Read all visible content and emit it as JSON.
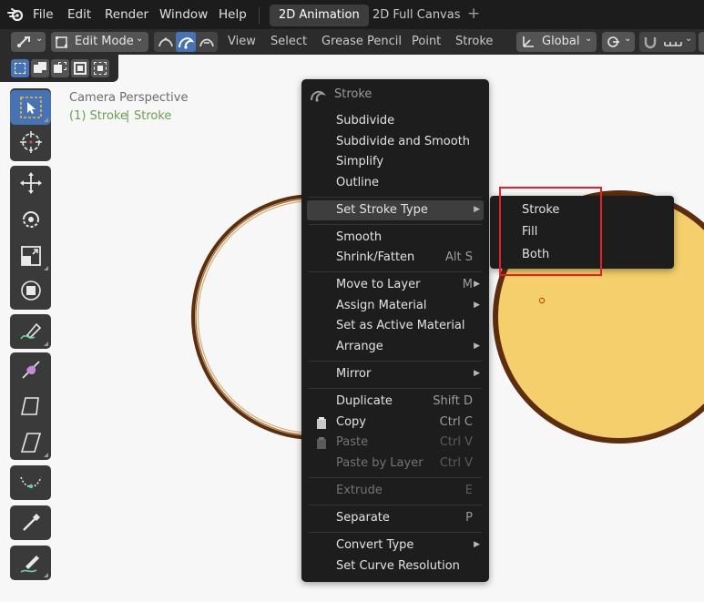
{
  "topbar": {
    "menus": [
      "File",
      "Edit",
      "Render",
      "Window",
      "Help"
    ],
    "tabs": [
      "2D Animation",
      "2D Full Canvas"
    ],
    "add_tab": "+"
  },
  "header": {
    "mode": "Edit Mode",
    "menus": [
      "View",
      "Select",
      "Grease Pencil",
      "Point",
      "Stroke"
    ],
    "orientation": "Global"
  },
  "viewport": {
    "camera": "Camera Perspective",
    "object_prefix": "(1) Stroke",
    "separator": "|",
    "object_name": "Stroke"
  },
  "context_menu": {
    "title": "Stroke",
    "items": [
      {
        "label": "Subdivide",
        "shortcut": ""
      },
      {
        "label": "Subdivide and Smooth",
        "shortcut": ""
      },
      {
        "label": "Simplify",
        "shortcut": ""
      },
      {
        "label": "Outline",
        "shortcut": ""
      },
      {
        "label": "Set Stroke Type",
        "shortcut": ""
      },
      {
        "label": "Smooth",
        "shortcut": ""
      },
      {
        "label": "Shrink/Fatten",
        "shortcut": "Alt S"
      },
      {
        "label": "Move to Layer",
        "shortcut": "M"
      },
      {
        "label": "Assign Material",
        "shortcut": ""
      },
      {
        "label": "Set as Active Material",
        "shortcut": ""
      },
      {
        "label": "Arrange",
        "shortcut": ""
      },
      {
        "label": "Mirror",
        "shortcut": ""
      },
      {
        "label": "Duplicate",
        "shortcut": "Shift D"
      },
      {
        "label": "Copy",
        "shortcut": "Ctrl C"
      },
      {
        "label": "Paste",
        "shortcut": "Ctrl V"
      },
      {
        "label": "Paste by Layer",
        "shortcut": "Ctrl V"
      },
      {
        "label": "Extrude",
        "shortcut": "E"
      },
      {
        "label": "Separate",
        "shortcut": "P"
      },
      {
        "label": "Convert Type",
        "shortcut": ""
      },
      {
        "label": "Set Curve Resolution",
        "shortcut": ""
      }
    ]
  },
  "submenu": {
    "items": [
      "Stroke",
      "Fill",
      "Both"
    ]
  },
  "colors": {
    "accent": "#4772b3",
    "highlight_box": "#e5202a",
    "fill_circle": "#f4cf6b",
    "stroke_brown": "#5c2e0e"
  }
}
